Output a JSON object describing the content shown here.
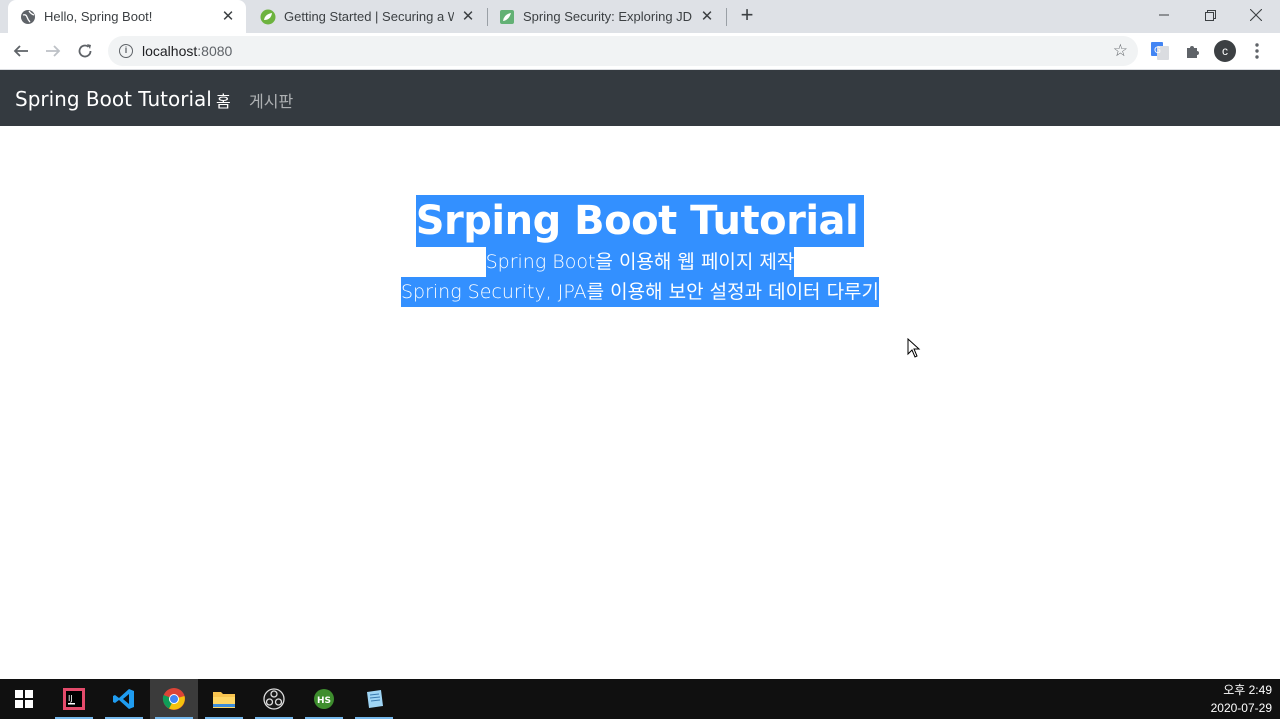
{
  "browser": {
    "tabs": [
      {
        "title": "Hello, Spring Boot!",
        "active": true
      },
      {
        "title": "Getting Started | Securing a We",
        "active": false
      },
      {
        "title": "Spring Security: Exploring JDBC",
        "active": false
      }
    ],
    "url_host": "localhost",
    "url_port": ":8080",
    "profile_initial": "c"
  },
  "navbar": {
    "brand": "Spring Boot Tutorial",
    "links": [
      "홈",
      "게시판"
    ]
  },
  "hero": {
    "title": "Srping Boot Tutorial",
    "lead_line1": "Spring Boot을 이용해 웹 페이지 제작",
    "lead_line2": "Spring Security, JPA를 이용해 보안 설정과 데이터 다루기"
  },
  "taskbar": {
    "apps": [
      "start-icon",
      "intellij-icon",
      "vscode-icon",
      "chrome-icon",
      "file-explorer-icon",
      "obs-icon",
      "heidisql-icon",
      "notepad-icon"
    ],
    "clock_time": "오후 2:49",
    "clock_date": "2020-07-29"
  },
  "colors": {
    "navbar_bg": "#343a40",
    "selection": "#3390ff",
    "taskbar_bg": "#101010"
  }
}
